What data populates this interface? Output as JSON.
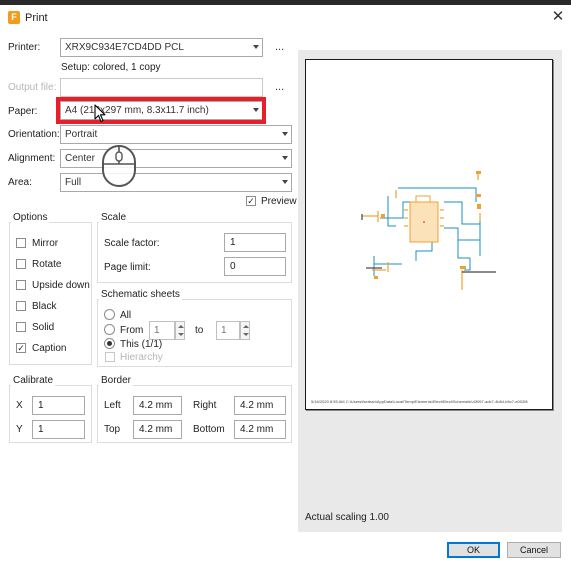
{
  "window": {
    "title": "Print",
    "icon": "F"
  },
  "printer": {
    "label": "Printer:",
    "value": "XRX9C934E7CD4DD PCL",
    "browse": "...",
    "setup_text": "Setup: colored, 1 copy"
  },
  "output_file": {
    "label": "Output file:",
    "value": "",
    "browse": "..."
  },
  "paper": {
    "label": "Paper:",
    "value": "A4 (210x297 mm, 8.3x11.7 inch)"
  },
  "orientation": {
    "label": "Orientation:",
    "value": "Portrait"
  },
  "alignment": {
    "label": "Alignment:",
    "value": "Center"
  },
  "area": {
    "label": "Area:",
    "value": "Full"
  },
  "preview": {
    "label": "Preview",
    "checked": true
  },
  "options": {
    "title": "Options",
    "items": [
      {
        "label": "Mirror",
        "checked": false
      },
      {
        "label": "Rotate",
        "checked": false
      },
      {
        "label": "Upside down",
        "checked": false
      },
      {
        "label": "Black",
        "checked": false
      },
      {
        "label": "Solid",
        "checked": false
      },
      {
        "label": "Caption",
        "checked": true
      }
    ]
  },
  "scale": {
    "title": "Scale",
    "factor_label": "Scale factor:",
    "factor_value": "1",
    "limit_label": "Page limit:",
    "limit_value": "0"
  },
  "sheets": {
    "title": "Schematic sheets",
    "all_label": "All",
    "from_label": "From",
    "from_value": "1",
    "to_label": "to",
    "to_value": "1",
    "this_label": "This (1/1)",
    "hierarchy_label": "Hierarchy"
  },
  "calibrate": {
    "title": "Calibrate",
    "x_label": "X",
    "x_value": "1",
    "y_label": "Y",
    "y_value": "1"
  },
  "border": {
    "title": "Border",
    "left_label": "Left",
    "left_value": "4.2 mm",
    "right_label": "Right",
    "right_value": "4.2 mm",
    "top_label": "Top",
    "top_value": "4.2 mm",
    "bottom_label": "Bottom",
    "bottom_value": "4.2 mm"
  },
  "preview_page": {
    "footer_text": "5/16/2020 8:55 AM   C:\\Users\\fserban\\AppData\\Local\\Temp\\Elements\\Elect\\Elect\\Schematic\\43097-adc7-4b84-b9c7-e002f8"
  },
  "actual_scaling": "Actual scaling 1.00",
  "buttons": {
    "ok": "OK",
    "cancel": "Cancel"
  },
  "colors": {
    "highlight": "#e81e2a",
    "wire": "#1a90c0",
    "component": "#f0a030",
    "accent": "#0078d7"
  }
}
